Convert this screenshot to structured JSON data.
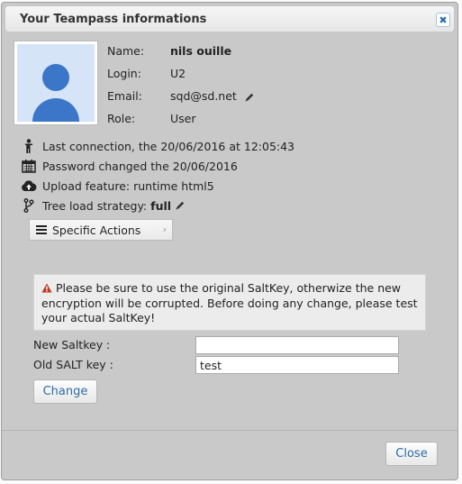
{
  "dialog": {
    "title": "Your Teampass informations",
    "close_icon": "close-icon"
  },
  "profile": {
    "avatar_icon": "user-avatar-icon",
    "fields": [
      {
        "label": "Name:",
        "value": "nils ouille"
      },
      {
        "label": "Login:",
        "value": "U2"
      },
      {
        "label": "Email:",
        "value": "sqd@sd.net"
      },
      {
        "label": "Role:",
        "value": "User"
      }
    ]
  },
  "status": {
    "last_connection": "Last connection, the 20/06/2016 at 12:05:43",
    "password_changed": "Password changed the 20/06/2016",
    "upload_feature": "Upload feature: runtime html5",
    "tree_label": "Tree load strategy:",
    "tree_value": "full"
  },
  "actions": {
    "label": "Specific Actions"
  },
  "warning": {
    "text": "Please be sure to use the original SaltKey, otherwize the new encryption will be corrupted. Before doing any change, please test your actual SaltKey!"
  },
  "saltkey": {
    "new_label": "New Saltkey :",
    "new_value": "",
    "old_label": "Old SALT key :",
    "old_value": "test",
    "change_button": "Change"
  },
  "footer": {
    "close_button": "Close"
  },
  "colors": {
    "accent": "#2e6ca5",
    "avatar": "#3c76c8",
    "warning": "#c0392b"
  }
}
